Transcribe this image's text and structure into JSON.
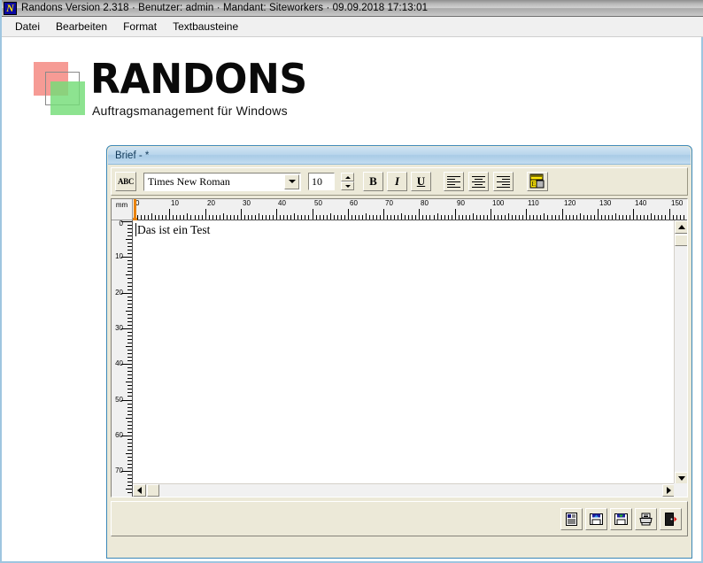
{
  "window": {
    "title": "Randons Version 2.318 · Benutzer: admin · Mandant: Siteworkers · 09.09.2018 17:13:01",
    "app_icon": "N",
    "app_name": "Randons",
    "version": "2.318",
    "user": "admin",
    "client": "Siteworkers",
    "datetime": "09.09.2018 17:13:01"
  },
  "menubar": {
    "items": [
      {
        "label": "Datei"
      },
      {
        "label": "Bearbeiten"
      },
      {
        "label": "Format"
      },
      {
        "label": "Textbausteine"
      }
    ]
  },
  "logo": {
    "wordmark": "RANDONS",
    "tagline": "Auftragsmanagement für Windows",
    "colors": {
      "red": "#f48a82",
      "green": "#74dd78"
    }
  },
  "document_window": {
    "title": "Brief - *",
    "toolbar": {
      "spellcheck_label": "ABC",
      "font_name": "Times New Roman",
      "font_size": "10",
      "bold_label": "B",
      "italic_label": "I",
      "underline_label": "U",
      "align_left_title": "Linksbündig",
      "align_center_title": "Zentriert",
      "align_right_title": "Rechtsbündig",
      "ruler_title": "Lineal"
    },
    "ruler": {
      "unit": "mm",
      "horizontal_labels": [
        "0",
        "10",
        "20",
        "30",
        "40",
        "50",
        "60",
        "70",
        "80",
        "90",
        "100",
        "110",
        "120",
        "130",
        "140",
        "150"
      ],
      "vertical_labels": [
        "0",
        "10",
        "20",
        "30",
        "40",
        "50",
        "60",
        "70"
      ],
      "h_max_mm": 155,
      "v_max_mm": 76,
      "margin_marker_mm": 0
    },
    "content": {
      "text": "Das ist ein Test"
    },
    "statusbar": {
      "buttons": [
        {
          "name": "preview-button",
          "icon": "document-icon"
        },
        {
          "name": "load-button",
          "icon": "floppy-open-icon"
        },
        {
          "name": "save-button",
          "icon": "floppy-save-icon"
        },
        {
          "name": "print-button",
          "icon": "printer-icon"
        },
        {
          "name": "exit-button",
          "icon": "exit-door-icon"
        }
      ]
    }
  },
  "colors": {
    "accent": "#3a87b7",
    "mdi_title": "#a8cbe6",
    "face": "#ece9d8",
    "ruler_marker": "#e8820c"
  }
}
